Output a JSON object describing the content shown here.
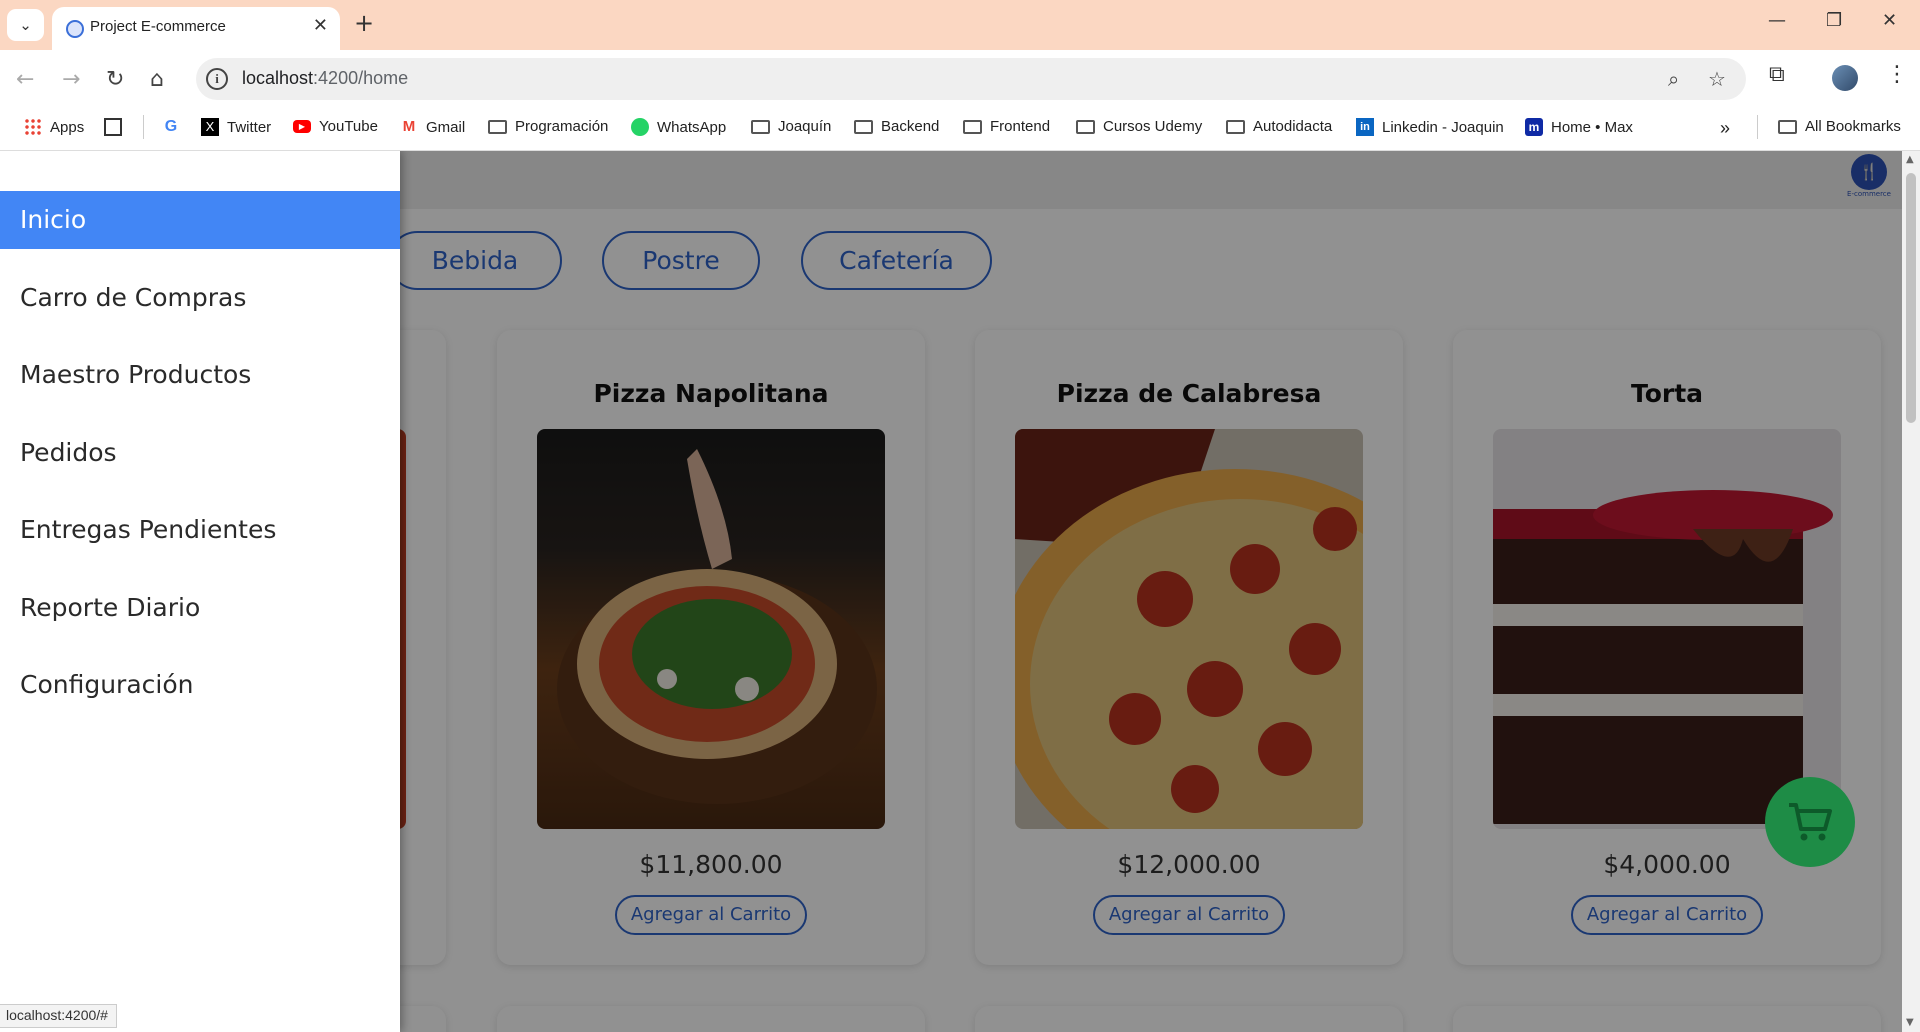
{
  "browser": {
    "tab_title": "Project E-commerce",
    "url_host": "localhost",
    "url_path": ":4200/home",
    "bookmarks": [
      {
        "label": "Apps",
        "icon": "apps-grid-icon"
      },
      {
        "label": "",
        "icon": "grid-icon"
      },
      {
        "label": "",
        "icon": "google-icon"
      },
      {
        "label": "Twitter",
        "icon": "x-icon"
      },
      {
        "label": "YouTube",
        "icon": "youtube-icon"
      },
      {
        "label": "Gmail",
        "icon": "gmail-icon"
      },
      {
        "label": "Programación",
        "icon": "folder-icon"
      },
      {
        "label": "WhatsApp",
        "icon": "whatsapp-icon"
      },
      {
        "label": "Joaquín",
        "icon": "folder-icon"
      },
      {
        "label": "Backend",
        "icon": "folder-icon"
      },
      {
        "label": "Frontend",
        "icon": "folder-icon"
      },
      {
        "label": "Cursos Udemy",
        "icon": "folder-icon"
      },
      {
        "label": "Autodidacta",
        "icon": "folder-icon"
      },
      {
        "label": "Linkedin - Joaquin",
        "icon": "linkedin-icon"
      },
      {
        "label": "Home • Max",
        "icon": "max-icon"
      }
    ],
    "all_bookmarks": "All Bookmarks",
    "overflow": "»",
    "status_url": "localhost:4200/#"
  },
  "header": {
    "logo_text": "E-commerce"
  },
  "categories": [
    "Bebida",
    "Postre",
    "Cafetería"
  ],
  "products": [
    {
      "name": "Pizza Napolitana",
      "price": "$11,800.00",
      "button": "Agregar al Carrito"
    },
    {
      "name": "Pizza de Calabresa",
      "price": "$12,000.00",
      "button": "Agregar al Carrito"
    },
    {
      "name": "Torta",
      "price": "$4,000.00",
      "button": "Agregar al Carrito"
    }
  ],
  "sidenav": {
    "items": [
      {
        "label": "Inicio",
        "active": true
      },
      {
        "label": "Carro de Compras",
        "active": false
      },
      {
        "label": "Maestro Productos",
        "active": false
      },
      {
        "label": "Pedidos",
        "active": false
      },
      {
        "label": "Entregas Pendientes",
        "active": false
      },
      {
        "label": "Reporte Diario",
        "active": false
      },
      {
        "label": "Configuración",
        "active": false
      }
    ]
  },
  "colors": {
    "accent": "#2f63c9",
    "nav_active": "#4286f5",
    "cart_fab": "#1e8c46",
    "tabbar": "#fbd7c2"
  }
}
